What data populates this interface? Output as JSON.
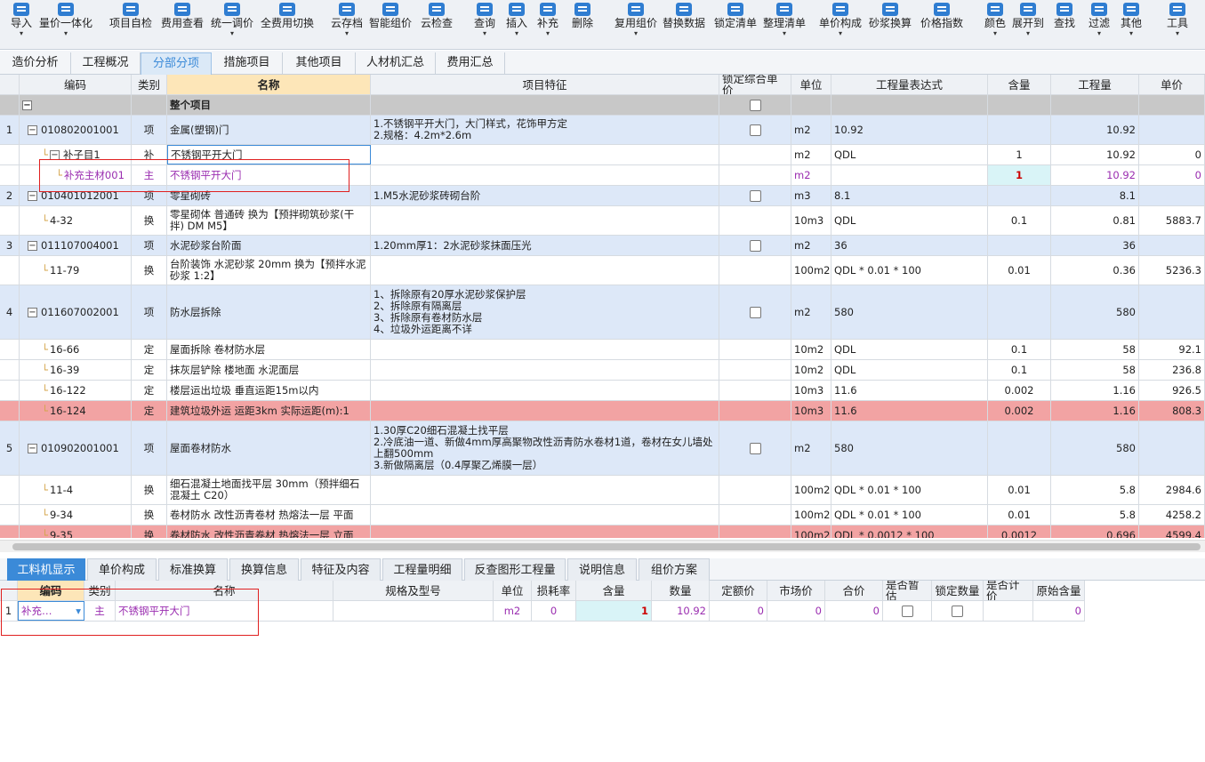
{
  "toolbar": [
    {
      "label": "导入",
      "dd": true
    },
    {
      "label": "量价一体化",
      "dd": true
    },
    {
      "label": "项目自检",
      "dd": false
    },
    {
      "label": "费用查看",
      "dd": false
    },
    {
      "label": "统一调价",
      "dd": true
    },
    {
      "label": "全费用切换",
      "dd": false
    },
    {
      "label": "云存档",
      "dd": true
    },
    {
      "label": "智能组价",
      "dd": false
    },
    {
      "label": "云检查",
      "dd": false
    },
    {
      "label": "查询",
      "dd": true
    },
    {
      "label": "插入",
      "dd": true
    },
    {
      "label": "补充",
      "dd": true
    },
    {
      "label": "删除",
      "dd": false
    },
    {
      "label": "复用组价",
      "dd": true
    },
    {
      "label": "替换数据",
      "dd": false
    },
    {
      "label": "锁定清单",
      "dd": false
    },
    {
      "label": "整理清单",
      "dd": true
    },
    {
      "label": "单价构成",
      "dd": true
    },
    {
      "label": "砂浆换算",
      "dd": false
    },
    {
      "label": "价格指数",
      "dd": false
    },
    {
      "label": "颜色",
      "dd": true
    },
    {
      "label": "展开到",
      "dd": true
    },
    {
      "label": "查找",
      "dd": false
    },
    {
      "label": "过滤",
      "dd": true
    },
    {
      "label": "其他",
      "dd": true
    },
    {
      "label": "工具",
      "dd": true
    }
  ],
  "tabs": [
    "造价分析",
    "工程概况",
    "分部分项",
    "措施项目",
    "其他项目",
    "人材机汇总",
    "费用汇总"
  ],
  "active_tab": "分部分项",
  "columns": [
    "编码",
    "类别",
    "名称",
    "项目特征",
    "锁定综合单价",
    "单位",
    "工程量表达式",
    "含量",
    "工程量",
    "单价"
  ],
  "whole_project": "整个项目",
  "rows": [
    {
      "no": "1",
      "code": "010802001001",
      "type": "项",
      "name": "金属(塑钢)门",
      "feature": "1.不锈钢平开大门，大门样式，花饰甲方定\n2.规格：4.2m*2.6m",
      "lock": true,
      "unit": "m2",
      "expr": "10.92",
      "content": "",
      "qty": "10.92",
      "price": "",
      "style": "blue",
      "level": 0,
      "exp": "−"
    },
    {
      "no": "",
      "code": "补子目1",
      "type": "补",
      "name": "不锈钢平开大门",
      "feature": "",
      "lock": false,
      "unit": "m2",
      "expr": "QDL",
      "content": "1",
      "qty": "10.92",
      "price": "0",
      "style": "white",
      "level": 1,
      "exp": "−"
    },
    {
      "no": "",
      "code": "补充主材001",
      "type": "主",
      "name": "不锈钢平开大门",
      "feature": "",
      "lock": false,
      "unit": "m2",
      "expr": "",
      "content": "1",
      "qty": "10.92",
      "price": "0",
      "style": "white",
      "level": 2,
      "exp": "",
      "purple": true
    },
    {
      "no": "2",
      "code": "010401012001",
      "type": "项",
      "name": "零星砌砖",
      "feature": "1.M5水泥砂浆砖砌台阶",
      "lock": true,
      "unit": "m3",
      "expr": "8.1",
      "content": "",
      "qty": "8.1",
      "price": "",
      "style": "blue",
      "level": 0,
      "exp": "−"
    },
    {
      "no": "",
      "code": "4-32",
      "type": "换",
      "name": "零星砌体 普通砖  换为【预拌砌筑砂浆(干拌) DM M5】",
      "feature": "",
      "lock": false,
      "unit": "10m3",
      "expr": "QDL",
      "content": "0.1",
      "qty": "0.81",
      "price": "5883.7",
      "style": "white",
      "level": 1,
      "exp": ""
    },
    {
      "no": "3",
      "code": "011107004001",
      "type": "项",
      "name": "水泥砂浆台阶面",
      "feature": "1.20mm厚1：2水泥砂浆抹面压光",
      "lock": true,
      "unit": "m2",
      "expr": "36",
      "content": "",
      "qty": "36",
      "price": "",
      "style": "blue",
      "level": 0,
      "exp": "−"
    },
    {
      "no": "",
      "code": "11-79",
      "type": "换",
      "name": "台阶装饰 水泥砂浆 20mm   换为【预拌水泥砂浆 1:2】",
      "feature": "",
      "lock": false,
      "unit": "100m2",
      "expr": "QDL * 0.01 * 100",
      "content": "0.01",
      "qty": "0.36",
      "price": "5236.3",
      "style": "white",
      "level": 1,
      "exp": ""
    },
    {
      "no": "4",
      "code": "011607002001",
      "type": "项",
      "name": "防水层拆除",
      "feature": "1、拆除原有20厚水泥砂浆保护层\n2、拆除原有隔离层\n3、拆除原有卷材防水层\n4、垃圾外运距离不详",
      "lock": true,
      "unit": "m2",
      "expr": "580",
      "content": "",
      "qty": "580",
      "price": "",
      "style": "blue",
      "level": 0,
      "exp": "−"
    },
    {
      "no": "",
      "code": "16-66",
      "type": "定",
      "name": "屋面拆除 卷材防水层",
      "feature": "",
      "lock": false,
      "unit": "10m2",
      "expr": "QDL",
      "content": "0.1",
      "qty": "58",
      "price": "92.1",
      "style": "white",
      "level": 1,
      "exp": ""
    },
    {
      "no": "",
      "code": "16-39",
      "type": "定",
      "name": "抹灰层铲除 楼地面 水泥面层",
      "feature": "",
      "lock": false,
      "unit": "10m2",
      "expr": "QDL",
      "content": "0.1",
      "qty": "58",
      "price": "236.8",
      "style": "white",
      "level": 1,
      "exp": ""
    },
    {
      "no": "",
      "code": "16-122",
      "type": "定",
      "name": "楼层运出垃圾 垂直运距15m以内",
      "feature": "",
      "lock": false,
      "unit": "10m3",
      "expr": "11.6",
      "content": "0.002",
      "qty": "1.16",
      "price": "926.5",
      "style": "white",
      "level": 1,
      "exp": ""
    },
    {
      "no": "",
      "code": "16-124",
      "type": "定",
      "name": "建筑垃圾外运 运距3km  实际运距(m):1",
      "feature": "",
      "lock": false,
      "unit": "10m3",
      "expr": "11.6",
      "content": "0.002",
      "qty": "1.16",
      "price": "808.3",
      "style": "pink",
      "level": 1,
      "exp": ""
    },
    {
      "no": "5",
      "code": "010902001001",
      "type": "项",
      "name": "屋面卷材防水",
      "feature": "1.30厚C20细石混凝土找平层\n2.冷底油一道、新做4mm厚高聚物改性沥青防水卷材1道，卷材在女儿墙处上翻500mm\n3.新做隔离层（0.4厚聚乙烯膜一层）",
      "lock": true,
      "unit": "m2",
      "expr": "580",
      "content": "",
      "qty": "580",
      "price": "",
      "style": "blue",
      "level": 0,
      "exp": "−"
    },
    {
      "no": "",
      "code": "11-4",
      "type": "换",
      "name": "细石混凝土地面找平层 30mm（预拌细石混凝土 C20）",
      "feature": "",
      "lock": false,
      "unit": "100m2",
      "expr": "QDL * 0.01 * 100",
      "content": "0.01",
      "qty": "5.8",
      "price": "2984.6",
      "style": "white",
      "level": 1,
      "exp": ""
    },
    {
      "no": "",
      "code": "9-34",
      "type": "换",
      "name": "卷材防水 改性沥青卷材 热熔法一层 平面",
      "feature": "",
      "lock": false,
      "unit": "100m2",
      "expr": "QDL * 0.01 * 100",
      "content": "0.01",
      "qty": "5.8",
      "price": "4258.2",
      "style": "white",
      "level": 1,
      "exp": ""
    },
    {
      "no": "",
      "code": "9-35",
      "type": "换",
      "name": "卷材防水 改性沥青卷材 热熔法一层 立面",
      "feature": "",
      "lock": false,
      "unit": "100m2",
      "expr": "QDL * 0.0012 * 100",
      "content": "0.0012",
      "qty": "0.696",
      "price": "4599.4",
      "style": "pink",
      "level": 1,
      "exp": ""
    }
  ],
  "lower_tabs": [
    "工料机显示",
    "单价构成",
    "标准换算",
    "换算信息",
    "特征及内容",
    "工程量明细",
    "反查图形工程量",
    "说明信息",
    "组价方案"
  ],
  "lower_active": "工料机显示",
  "lower_columns": [
    "编码",
    "类别",
    "名称",
    "规格及型号",
    "单位",
    "损耗率",
    "含量",
    "数量",
    "定额价",
    "市场价",
    "合价",
    "是否暂估",
    "锁定数量",
    "是否计价",
    "原始含量"
  ],
  "lower_rows": [
    {
      "no": "1",
      "code": "补充…",
      "type": "主",
      "name": "不锈钢平开大门",
      "spec": "",
      "unit": "m2",
      "loss": "0",
      "content": "1",
      "qty": "10.92",
      "quota": "0",
      "market": "0",
      "total": "0",
      "provisional": false,
      "lockqty": false,
      "priced": "",
      "orig": "0"
    }
  ]
}
